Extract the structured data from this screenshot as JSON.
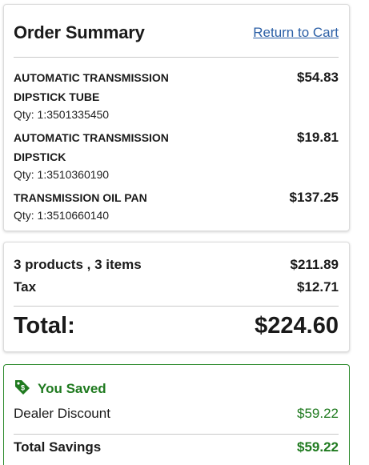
{
  "summary": {
    "title": "Order Summary",
    "return_link": "Return to Cart"
  },
  "items": [
    {
      "name_line1": "AUTOMATIC TRANSMISSION",
      "name_line2": "DIPSTICK TUBE",
      "qty": "Qty: 1:3501335450",
      "price": "$54.83"
    },
    {
      "name_line1": "AUTOMATIC TRANSMISSION",
      "name_line2": "DIPSTICK",
      "qty": "Qty: 1:3510360190",
      "price": "$19.81"
    },
    {
      "name_line1": "TRANSMISSION OIL PAN",
      "name_line2": "",
      "qty": "Qty: 1:3510660140",
      "price": "$137.25"
    }
  ],
  "totals": {
    "products_label": "3 products , 3 items",
    "products_value": "$211.89",
    "tax_label": "Tax",
    "tax_value": "$12.71",
    "total_label": "Total:",
    "total_value": "$224.60"
  },
  "savings": {
    "heading": "You Saved",
    "discount_label": "Dealer Discount",
    "discount_value": "$59.22",
    "total_label": "Total Savings",
    "total_value": "$59.22",
    "icon": "price-tag-icon",
    "accent": "#1f7a1f"
  }
}
